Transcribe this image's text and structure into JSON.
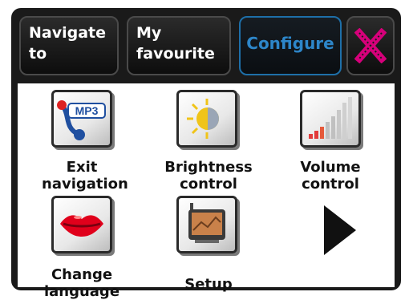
{
  "toolbar": {
    "tabs": [
      {
        "line1": "Navigate",
        "line2": "to"
      },
      {
        "line1": "My",
        "line2": "favourite"
      },
      {
        "label": "Configure"
      }
    ],
    "close_icon": "close-x-icon"
  },
  "menu": {
    "items": [
      {
        "line1": "Exit",
        "line2": "navigation",
        "icon": "mp3-icon",
        "icon_text": "MP3"
      },
      {
        "line1": "Brightness",
        "line2": "control",
        "icon": "brightness-icon"
      },
      {
        "line1": "Volume",
        "line2": "control",
        "icon": "volume-bars-icon"
      },
      {
        "line1": "Change",
        "line2": "language",
        "icon": "lips-icon"
      },
      {
        "line1": "Setup",
        "icon": "device-setup-icon"
      }
    ],
    "next_icon": "next-page-arrow-icon"
  },
  "colors": {
    "accent": "#2d86c9",
    "close": "#d6007a",
    "frame": "#1a1a1a"
  }
}
